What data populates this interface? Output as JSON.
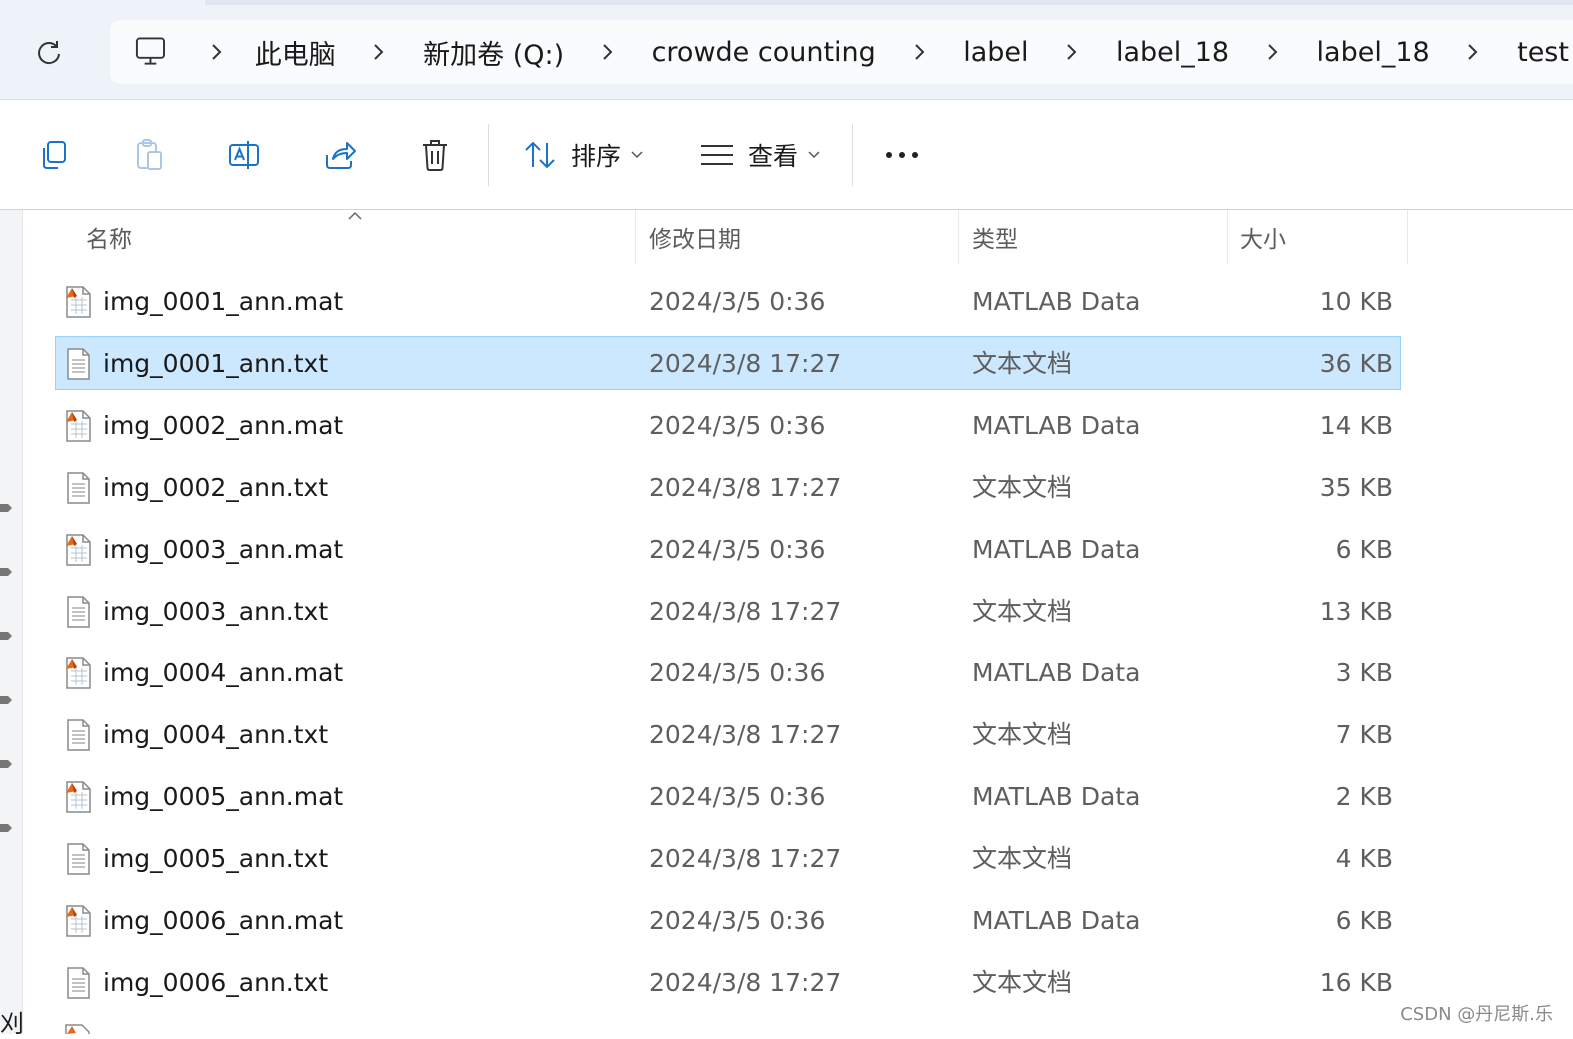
{
  "breadcrumb": {
    "items": [
      "此电脑",
      "新加卷 (Q:)",
      "crowde counting",
      "label",
      "label_18",
      "label_18",
      "test"
    ]
  },
  "toolbar": {
    "sort_label": "排序",
    "view_label": "查看"
  },
  "columns": {
    "name": "名称",
    "modified": "修改日期",
    "type": "类型",
    "size": "大小"
  },
  "files": [
    {
      "name": "img_0001_ann.mat",
      "modified": "2024/3/5 0:36",
      "type": "MATLAB Data",
      "size": "10 KB",
      "icon": "matlab-file-icon",
      "selected": false
    },
    {
      "name": "img_0001_ann.txt",
      "modified": "2024/3/8 17:27",
      "type": "文本文档",
      "size": "36 KB",
      "icon": "text-file-icon",
      "selected": true
    },
    {
      "name": "img_0002_ann.mat",
      "modified": "2024/3/5 0:36",
      "type": "MATLAB Data",
      "size": "14 KB",
      "icon": "matlab-file-icon",
      "selected": false
    },
    {
      "name": "img_0002_ann.txt",
      "modified": "2024/3/8 17:27",
      "type": "文本文档",
      "size": "35 KB",
      "icon": "text-file-icon",
      "selected": false
    },
    {
      "name": "img_0003_ann.mat",
      "modified": "2024/3/5 0:36",
      "type": "MATLAB Data",
      "size": "6 KB",
      "icon": "matlab-file-icon",
      "selected": false
    },
    {
      "name": "img_0003_ann.txt",
      "modified": "2024/3/8 17:27",
      "type": "文本文档",
      "size": "13 KB",
      "icon": "text-file-icon",
      "selected": false
    },
    {
      "name": "img_0004_ann.mat",
      "modified": "2024/3/5 0:36",
      "type": "MATLAB Data",
      "size": "3 KB",
      "icon": "matlab-file-icon",
      "selected": false
    },
    {
      "name": "img_0004_ann.txt",
      "modified": "2024/3/8 17:27",
      "type": "文本文档",
      "size": "7 KB",
      "icon": "text-file-icon",
      "selected": false
    },
    {
      "name": "img_0005_ann.mat",
      "modified": "2024/3/5 0:36",
      "type": "MATLAB Data",
      "size": "2 KB",
      "icon": "matlab-file-icon",
      "selected": false
    },
    {
      "name": "img_0005_ann.txt",
      "modified": "2024/3/8 17:27",
      "type": "文本文档",
      "size": "4 KB",
      "icon": "text-file-icon",
      "selected": false
    },
    {
      "name": "img_0006_ann.mat",
      "modified": "2024/3/5 0:36",
      "type": "MATLAB Data",
      "size": "6 KB",
      "icon": "matlab-file-icon",
      "selected": false
    },
    {
      "name": "img_0006_ann.txt",
      "modified": "2024/3/8 17:27",
      "type": "文本文档",
      "size": "16 KB",
      "icon": "text-file-icon",
      "selected": false
    }
  ],
  "left_pane": {
    "cut_text": "刈"
  },
  "watermark": "CSDN @丹尼斯.乐",
  "colors": {
    "selection_bg": "#cce8ff",
    "selection_border": "#99d1ff",
    "accent": "#1a73c9",
    "matlab_orange": "#e16c1f"
  }
}
